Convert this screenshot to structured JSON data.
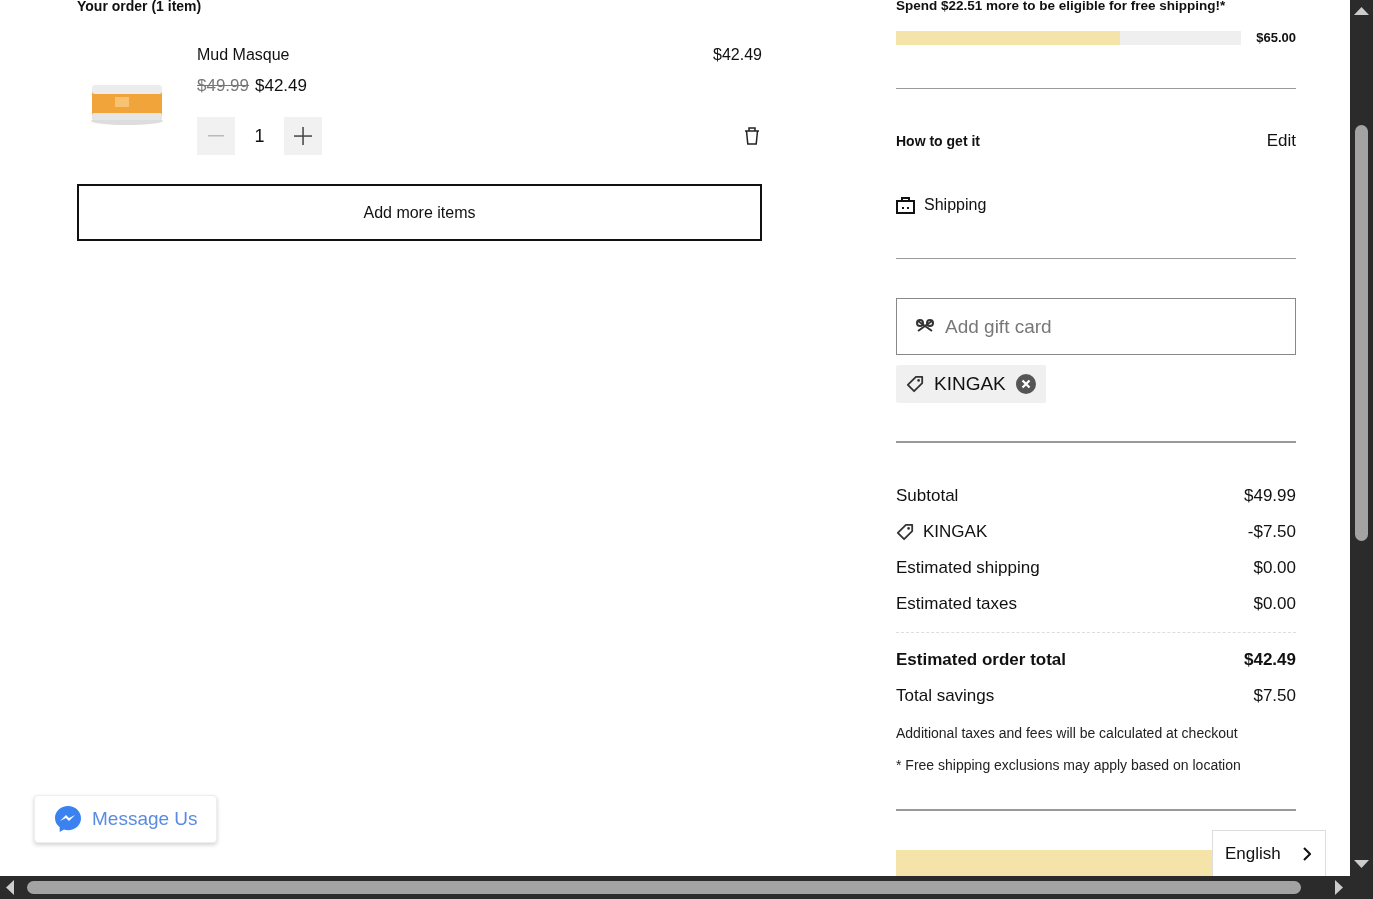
{
  "order": {
    "heading": "Your order (1 item)",
    "items": [
      {
        "name": "Mud Masque",
        "line_total": "$42.49",
        "original_price": "$49.99",
        "price": "$42.49",
        "quantity": "1",
        "decrease_disabled": true
      }
    ],
    "add_more": "Add more items"
  },
  "shipping_progress": {
    "message": "Spend $22.51 more to be eligible for free shipping!*",
    "level": 0.65,
    "threshold": "$65.00"
  },
  "fulfillment": {
    "heading": "How to get it",
    "edit": "Edit",
    "method": "Shipping"
  },
  "gift_card": {
    "placeholder": "Add gift card"
  },
  "promo_codes": [
    "KINGAK"
  ],
  "summary": {
    "rows": [
      {
        "label": "Subtotal",
        "value": "$49.99",
        "kind": "plain"
      },
      {
        "label": "KINGAK",
        "value": "-$7.50",
        "kind": "discount"
      },
      {
        "label": "Estimated shipping",
        "value": "$0.00",
        "kind": "plain"
      },
      {
        "label": "Estimated taxes",
        "value": "$0.00",
        "kind": "plain"
      }
    ],
    "total": {
      "label": "Estimated order total",
      "value": "$42.49"
    },
    "savings": {
      "label": "Total savings",
      "value": "$7.50"
    },
    "notes": [
      "Additional taxes and fees will be calculated at checkout",
      "* Free shipping exclusions may apply based on location"
    ]
  },
  "chat_button": "Message Us",
  "language": "English"
}
